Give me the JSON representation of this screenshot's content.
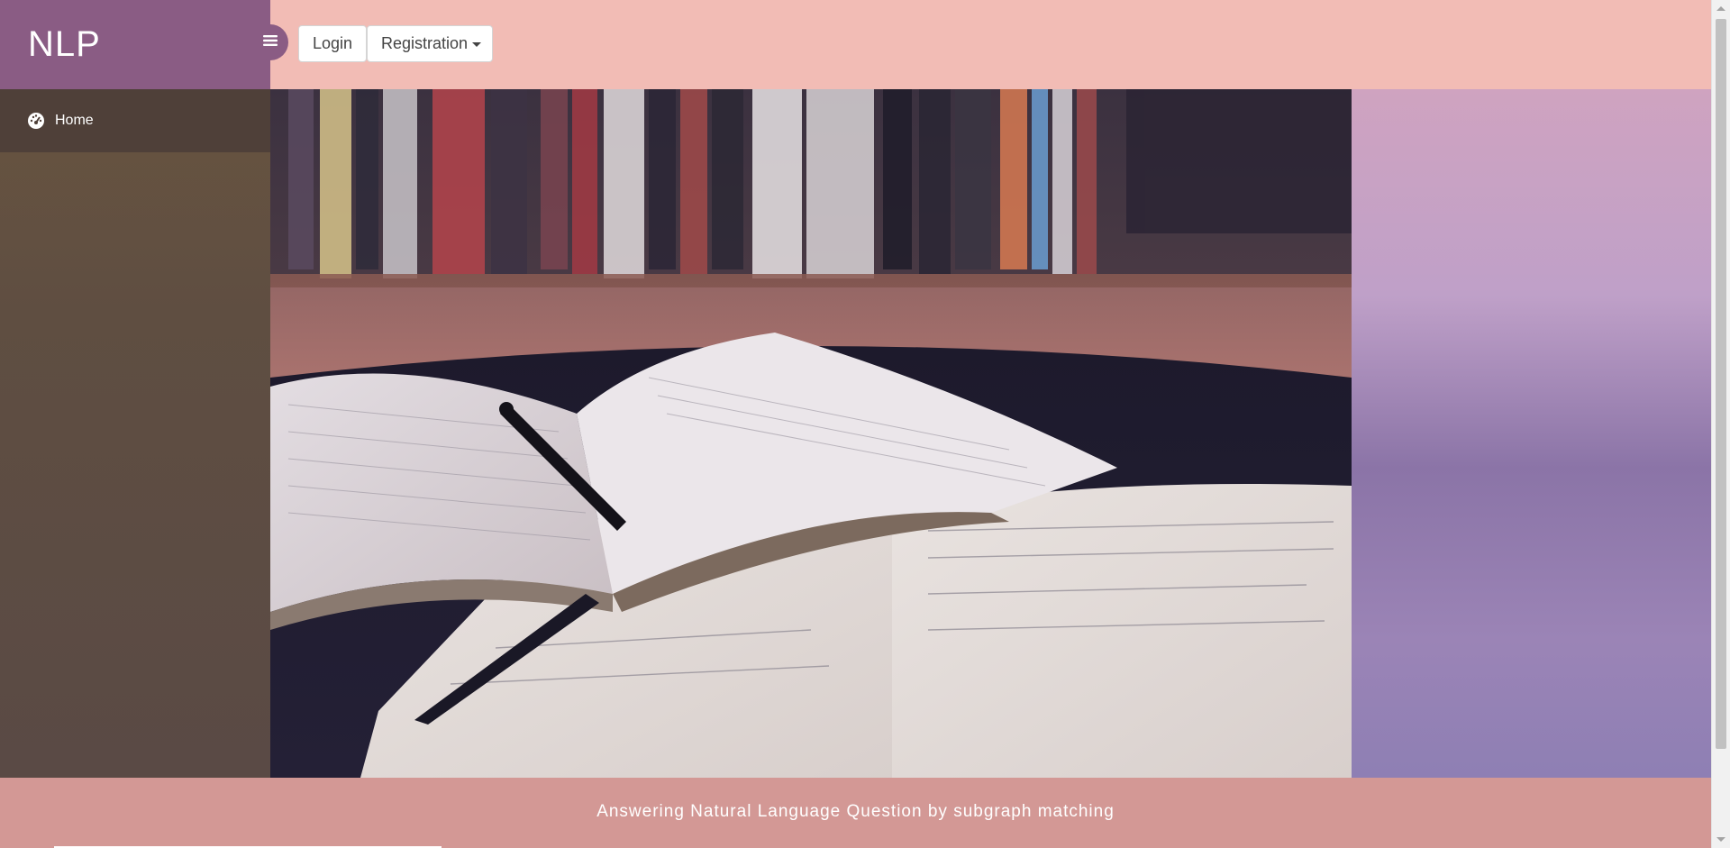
{
  "brand": {
    "title": "NLP",
    "color": "#8a5c84"
  },
  "sidebar": {
    "items": [
      {
        "label": "Home",
        "icon": "dashboard-icon"
      }
    ]
  },
  "topbar": {
    "toggle_icon": "hamburger-icon",
    "login_label": "Login",
    "registration_label": "Registration",
    "background": "#f2bcb5"
  },
  "hero": {
    "image_description_icon": "books-photo"
  },
  "footer": {
    "text": "Answering Natural Language Question by subgraph matching",
    "background": "#d39895"
  }
}
